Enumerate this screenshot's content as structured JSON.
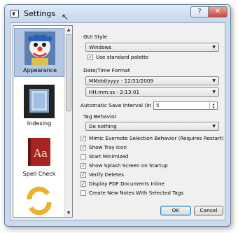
{
  "window": {
    "title": "Settings",
    "help_label": "?",
    "close_label": "✕"
  },
  "sidebar": {
    "items": [
      {
        "label": "Appearance",
        "icon": "clown-icon",
        "selected": true
      },
      {
        "label": "Indexing",
        "icon": "glass-tile-icon",
        "selected": false
      },
      {
        "label": "Spell Check",
        "icon": "dictionary-icon",
        "selected": false
      },
      {
        "label": "",
        "icon": "sync-arrows-icon",
        "selected": false
      }
    ]
  },
  "gui_style": {
    "label": "GUI Style",
    "value": "Windows",
    "use_palette_label": "Use standard palette",
    "use_palette_checked": true
  },
  "datetime": {
    "label": "Date/Time Format",
    "date_value": "MM/dd/yyyy - 12/31/2009",
    "time_value": "HH:mm:ss - 2:13:01"
  },
  "autosave": {
    "label": "Automatic Save Interval (in Minutes)",
    "value": "5"
  },
  "tag_behavior": {
    "label": "Tag Behavior",
    "value": "Do nothing"
  },
  "options": [
    {
      "label": "Mimic Evernote Selection Behavior (Requires Restart)",
      "checked": true
    },
    {
      "label": "Show Tray Icon",
      "checked": true
    },
    {
      "label": "Start Minimized",
      "checked": false
    },
    {
      "label": "Show Splash Screen on Startup",
      "checked": true
    },
    {
      "label": "Verify Deletes",
      "checked": true
    },
    {
      "label": "Display PDF Documents Inline",
      "checked": true
    },
    {
      "label": "Create New Notes With Selected Tags",
      "checked": false
    }
  ],
  "buttons": {
    "ok": "OK",
    "cancel": "Cancel"
  },
  "colors": {
    "title_bar": "#c9dbef",
    "selected_item": "#b4c8e4",
    "close_button": "#c8483a"
  }
}
